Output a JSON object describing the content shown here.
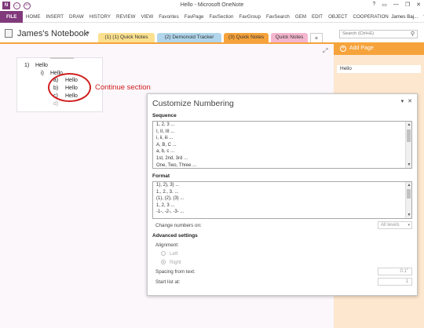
{
  "app": {
    "icon_text": "N",
    "title": "Hello - Microsoft OneNote",
    "window_controls": [
      "?",
      "▭",
      "—",
      "❐",
      "✕"
    ],
    "quick_access": [
      "←",
      "⇦"
    ]
  },
  "ribbon": {
    "tabs": [
      "FILE",
      "HOME",
      "INSERT",
      "DRAW",
      "HISTORY",
      "REVIEW",
      "VIEW",
      "Favorites",
      "FavPage",
      "FavSection",
      "FavGroup",
      "FavSearch",
      "GEM",
      "EDIT",
      "OBJECT",
      "COOPERATION"
    ],
    "user": "James Baj...",
    "collapse": "^"
  },
  "notebook": {
    "name": "James's Notebook",
    "chevron": "▼",
    "section_tabs": [
      {
        "label": "(1) (1) Quick Notes",
        "color": "#fbe18f"
      },
      {
        "label": "(2) Demonoid Tracker",
        "color": "#b1d6ec"
      },
      {
        "label": "(3) Quick Notes",
        "color": "#f6a33c"
      },
      {
        "label": "Quick Notes",
        "color": "#f4b6cf"
      }
    ],
    "add_tab": "+",
    "search_placeholder": "Search (Ctrl+E)",
    "search_icon": "search-icon"
  },
  "page": {
    "expand_icon": "⤢",
    "lines": [
      {
        "num": "1)",
        "text": "Hello"
      },
      {
        "num": "i)",
        "text": "Hello"
      },
      {
        "num": "a)",
        "text": "Hello"
      },
      {
        "num": "b)",
        "text": "Hello"
      },
      {
        "num": "c)",
        "text": "Hello"
      },
      {
        "num": "d)",
        "text": ""
      }
    ],
    "annotation": "Continue section",
    "annotation_color": "#d02020"
  },
  "page_panel": {
    "add_page": "Add Page",
    "pages": [
      "Hello"
    ]
  },
  "pane": {
    "title": "Customize Numbering",
    "dropdown_icon": "▾",
    "close_icon": "✕",
    "sequence_label": "Sequence",
    "sequence_items": [
      "1, 2, 3 ...",
      "I, II, III ...",
      "i, ii, iii ...",
      "A, B, C ...",
      "a, b, c ...",
      "1st, 2nd, 3rd ...",
      "One, Two, Three ..."
    ],
    "format_label": "Format",
    "format_items": [
      "1), 2), 3) ...",
      "1., 2., 3. ...",
      "(1), (2), (3) ...",
      "1, 2, 3 ...",
      "-1-, -2-, -3- ..."
    ],
    "change_numbers_label": "Change numbers on:",
    "change_numbers_value": "All levels",
    "advanced_label": "Advanced settings",
    "alignment_label": "Alignment:",
    "align_left": "Left",
    "align_right": "Right",
    "spacing_label": "Spacing from text:",
    "spacing_value": "0.1\"",
    "start_label": "Start list at:",
    "start_value": "1"
  }
}
